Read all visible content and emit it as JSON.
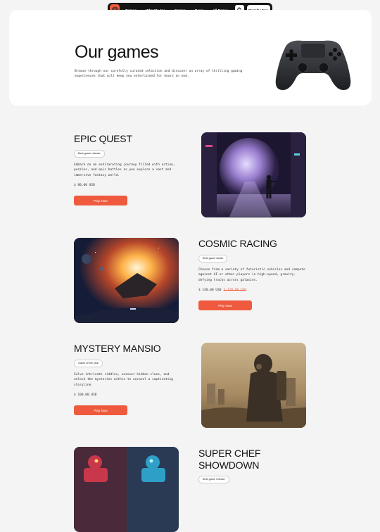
{
  "nav": {
    "links": [
      "Demos",
      "Who We Are",
      "Games",
      "News",
      "All Pages"
    ],
    "cta": "Start for Free",
    "logo_icon": "target-logo-icon",
    "cart_icon": "shopping-bag-icon"
  },
  "hero": {
    "title": "Our games",
    "description": "Browse through our carefully curated selection and discover an array of thrilling gaming experiences that will keep you entertained for hours on end."
  },
  "games": [
    {
      "title": "EPIC QUEST",
      "badge": "Best game release",
      "description": "Embark on an exhilarating journey filled with action, puzzles, and epic battles as you explore a vast and immersive fantasy world.",
      "price": "$ 80.00 USD",
      "old_price": "",
      "button": "Play Now"
    },
    {
      "title": "COSMIC RACING",
      "badge": "Best game studio",
      "description": "Choose from a variety of futuristic vehicles and compete against AI or other players in high-speed, gravity-defying tracks across galaxies.",
      "price": "$ 140.00 USD",
      "old_price": "$ 170.00 USD",
      "button": "Play Now"
    },
    {
      "title": "MYSTERY MANSIO",
      "badge": "Game of the year",
      "description": "Solve intricate riddles, uncover hidden clues, and unlock the mysteries within to unravel a captivating storyline.",
      "price": "$ 100.00 USD",
      "old_price": "",
      "button": "Play Now"
    },
    {
      "title": "SUPER CHEF SHOWDOWN",
      "badge": "Best game release",
      "description": "",
      "price": "",
      "old_price": "",
      "button": ""
    }
  ],
  "colors": {
    "accent": "#ef5a3e",
    "nav_bg": "#141414",
    "page_bg": "#f4f4f4"
  }
}
